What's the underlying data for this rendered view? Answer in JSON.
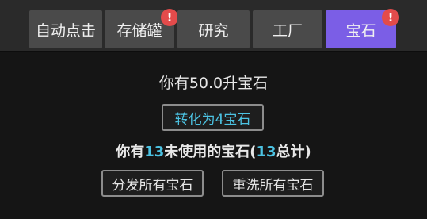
{
  "tabs": [
    {
      "label": "自动点击",
      "active": false,
      "alert": ""
    },
    {
      "label": "存储罐",
      "active": false,
      "alert": "!"
    },
    {
      "label": "研究",
      "active": false,
      "alert": ""
    },
    {
      "label": "工厂",
      "active": false,
      "alert": ""
    },
    {
      "label": "宝石",
      "active": true,
      "alert": "!"
    }
  ],
  "gems": {
    "liters_text": "你有50.0升宝石",
    "convert_button": "转化为4宝石",
    "unused_prefix": "你有",
    "unused_count": "13",
    "unused_middle": "未使用的宝石(",
    "total_count": "13",
    "unused_suffix": "总计)",
    "distribute_button": "分发所有宝石",
    "reset_button": "重洗所有宝石"
  },
  "colors": {
    "active_tab": "#7b5ee6",
    "alert_badge": "#e34b4b",
    "highlight_number": "#4cc3e3"
  }
}
